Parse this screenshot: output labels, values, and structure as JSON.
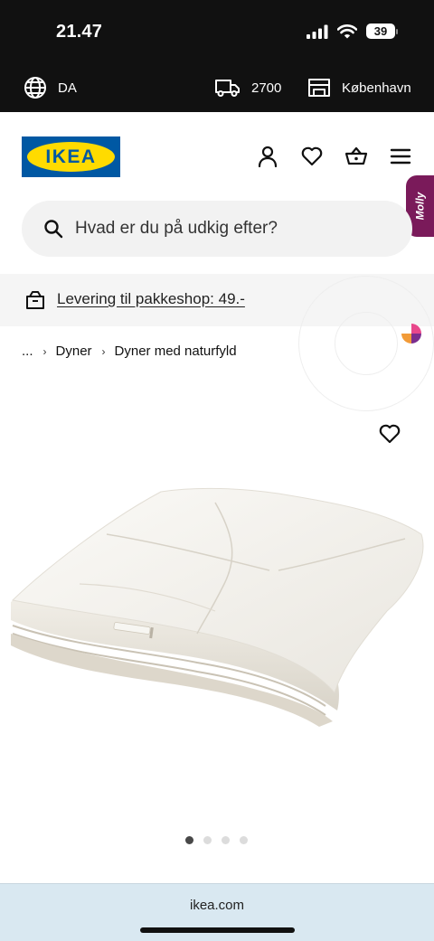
{
  "status_bar": {
    "time": "21.47",
    "battery": "39",
    "icons": [
      "signal-icon",
      "wifi-icon",
      "battery-icon"
    ]
  },
  "top_bar": {
    "language": "DA",
    "postal_code": "2700",
    "store": "København"
  },
  "header": {
    "logo_text": "IKEA",
    "icons": [
      "profile-icon",
      "heart-icon",
      "basket-icon",
      "menu-icon"
    ]
  },
  "chat": {
    "label": "Molly"
  },
  "search": {
    "placeholder": "Hvad er du på udkig efter?"
  },
  "delivery": {
    "text": "Levering til pakkeshop: 49.-"
  },
  "breadcrumb": {
    "ellipsis": "...",
    "items": [
      "Dyner",
      "Dyner med naturfyld"
    ]
  },
  "product": {
    "image": "duvet-product-image",
    "carousel": {
      "count": 4,
      "active": 0
    }
  },
  "browser": {
    "url": "ikea.com"
  },
  "colors": {
    "brand_blue": "#0058a3",
    "brand_yellow": "#ffdb00",
    "chat_purple": "#7a1a5a"
  }
}
